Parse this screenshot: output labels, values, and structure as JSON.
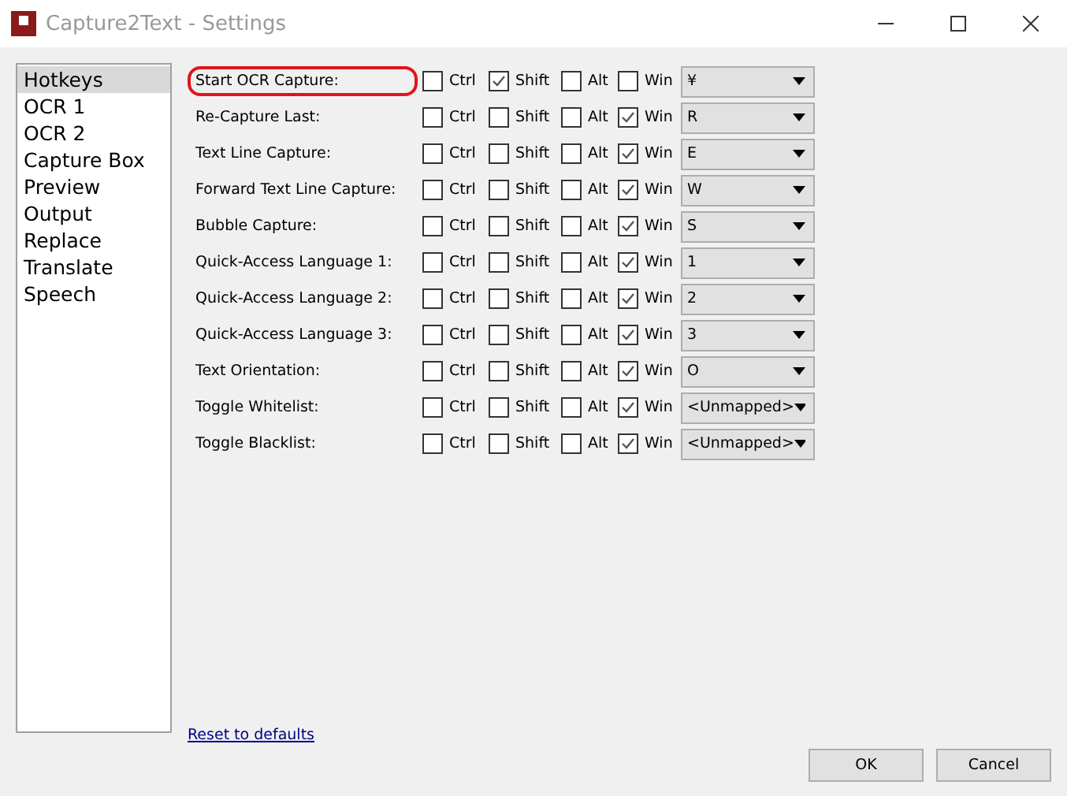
{
  "window": {
    "title": "Capture2Text - Settings"
  },
  "sidebar": {
    "items": [
      {
        "label": "Hotkeys",
        "selected": true
      },
      {
        "label": "OCR 1",
        "selected": false
      },
      {
        "label": "OCR 2",
        "selected": false
      },
      {
        "label": "Capture Box",
        "selected": false
      },
      {
        "label": "Preview",
        "selected": false
      },
      {
        "label": "Output",
        "selected": false
      },
      {
        "label": "Replace",
        "selected": false
      },
      {
        "label": "Translate",
        "selected": false
      },
      {
        "label": "Speech",
        "selected": false
      }
    ]
  },
  "hotkeys": [
    {
      "label": "Start OCR Capture:",
      "highlighted": true,
      "modifiers": [
        {
          "label": "Ctrl",
          "checked": false
        },
        {
          "label": "Shift",
          "checked": true
        },
        {
          "label": "Alt",
          "checked": false
        },
        {
          "label": "Win",
          "checked": false
        }
      ],
      "key": "¥"
    },
    {
      "label": "Re-Capture Last:",
      "highlighted": false,
      "modifiers": [
        {
          "label": "Ctrl",
          "checked": false
        },
        {
          "label": "Shift",
          "checked": false
        },
        {
          "label": "Alt",
          "checked": false
        },
        {
          "label": "Win",
          "checked": true
        }
      ],
      "key": "R"
    },
    {
      "label": "Text Line Capture:",
      "highlighted": false,
      "modifiers": [
        {
          "label": "Ctrl",
          "checked": false
        },
        {
          "label": "Shift",
          "checked": false
        },
        {
          "label": "Alt",
          "checked": false
        },
        {
          "label": "Win",
          "checked": true
        }
      ],
      "key": "E"
    },
    {
      "label": "Forward Text Line Capture:",
      "highlighted": false,
      "modifiers": [
        {
          "label": "Ctrl",
          "checked": false
        },
        {
          "label": "Shift",
          "checked": false
        },
        {
          "label": "Alt",
          "checked": false
        },
        {
          "label": "Win",
          "checked": true
        }
      ],
      "key": "W"
    },
    {
      "label": "Bubble Capture:",
      "highlighted": false,
      "modifiers": [
        {
          "label": "Ctrl",
          "checked": false
        },
        {
          "label": "Shift",
          "checked": false
        },
        {
          "label": "Alt",
          "checked": false
        },
        {
          "label": "Win",
          "checked": true
        }
      ],
      "key": "S"
    },
    {
      "label": "Quick-Access Language 1:",
      "highlighted": false,
      "modifiers": [
        {
          "label": "Ctrl",
          "checked": false
        },
        {
          "label": "Shift",
          "checked": false
        },
        {
          "label": "Alt",
          "checked": false
        },
        {
          "label": "Win",
          "checked": true
        }
      ],
      "key": "1"
    },
    {
      "label": "Quick-Access Language 2:",
      "highlighted": false,
      "modifiers": [
        {
          "label": "Ctrl",
          "checked": false
        },
        {
          "label": "Shift",
          "checked": false
        },
        {
          "label": "Alt",
          "checked": false
        },
        {
          "label": "Win",
          "checked": true
        }
      ],
      "key": "2"
    },
    {
      "label": "Quick-Access Language 3:",
      "highlighted": false,
      "modifiers": [
        {
          "label": "Ctrl",
          "checked": false
        },
        {
          "label": "Shift",
          "checked": false
        },
        {
          "label": "Alt",
          "checked": false
        },
        {
          "label": "Win",
          "checked": true
        }
      ],
      "key": "3"
    },
    {
      "label": "Text Orientation:",
      "highlighted": false,
      "modifiers": [
        {
          "label": "Ctrl",
          "checked": false
        },
        {
          "label": "Shift",
          "checked": false
        },
        {
          "label": "Alt",
          "checked": false
        },
        {
          "label": "Win",
          "checked": true
        }
      ],
      "key": "O"
    },
    {
      "label": "Toggle Whitelist:",
      "highlighted": false,
      "modifiers": [
        {
          "label": "Ctrl",
          "checked": false
        },
        {
          "label": "Shift",
          "checked": false
        },
        {
          "label": "Alt",
          "checked": false
        },
        {
          "label": "Win",
          "checked": true
        }
      ],
      "key": "<Unmapped>"
    },
    {
      "label": "Toggle Blacklist:",
      "highlighted": false,
      "modifiers": [
        {
          "label": "Ctrl",
          "checked": false
        },
        {
          "label": "Shift",
          "checked": false
        },
        {
          "label": "Alt",
          "checked": false
        },
        {
          "label": "Win",
          "checked": true
        }
      ],
      "key": "<Unmapped>"
    }
  ],
  "reset_link": "Reset to defaults",
  "buttons": [
    "OK",
    "Cancel"
  ]
}
